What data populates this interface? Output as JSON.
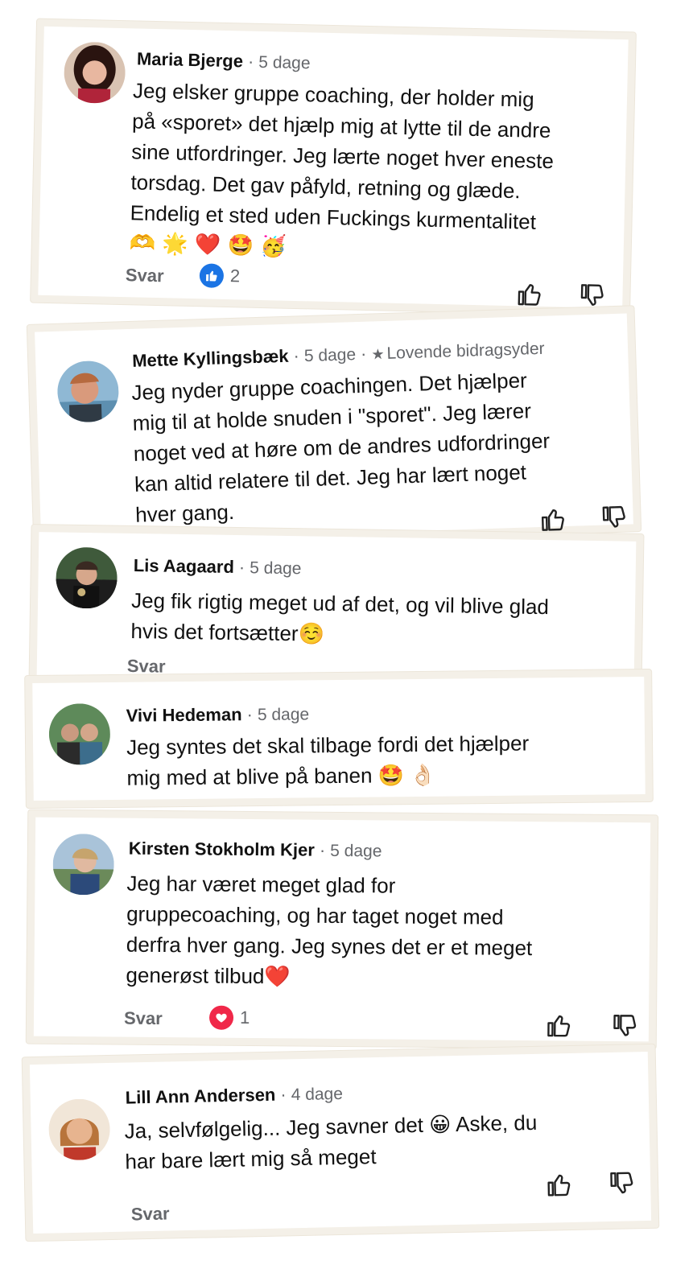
{
  "comments": [
    {
      "name": "Maria Bjerge",
      "time": "5 dage",
      "text": "Jeg elsker gruppe coaching, der holder mig\npå «sporet» det hjælp mig at lytte til de andre\nsine utfordringer. Jeg lærte noget hver eneste\ntorsdag. Det gav påfyld, retning og glæde.\nEndelig et sted uden Fuckings kurmentalitet",
      "emojis": "🫶 🌟 ❤️ 🤩 🥳",
      "reply_label": "Svar",
      "reaction_count": "2",
      "reaction_type": "like"
    },
    {
      "name": "Mette Kyllingsbæk",
      "time": "5 dage",
      "badge": "Lovende bidragsyder",
      "text": "Jeg nyder gruppe coachingen. Det hjælper\nmig til at holde snuden i \"sporet\". Jeg lærer\nnoget ved at høre om de andres udfordringer\nkan altid relatere til det. Jeg har lært noget\nhver gang."
    },
    {
      "name": "Lis Aagaard",
      "time": "5 dage",
      "text": "Jeg fik rigtig meget ud af det, og vil blive glad\nhvis det fortsætter☺️",
      "reply_label": "Svar"
    },
    {
      "name": "Vivi Hedeman",
      "time": "5 dage",
      "text": "Jeg syntes det skal tilbage fordi det hjælper\nmig med at blive på banen 🤩 👌🏻"
    },
    {
      "name": "Kirsten Stokholm Kjer",
      "time": "5 dage",
      "text": "Jeg har været meget glad for\ngruppecoaching, og har taget noget med\nderfra hver gang. Jeg synes det er et meget\ngenerøst tilbud❤️",
      "reply_label": "Svar",
      "reaction_count": "1",
      "reaction_type": "love"
    },
    {
      "name": "Lill Ann Andersen",
      "time": "4 dage",
      "text": "Ja, selvfølgelig... Jeg savner det 😀 Aske, du\nhar bare lært mig så meget",
      "reply_label": "Svar"
    }
  ],
  "colors": {
    "frame": "#f4f0e8",
    "meta_gray": "#65676b",
    "like_blue": "#1b74e4",
    "love_red": "#f02849"
  },
  "icons": [
    "thumbs-up-icon",
    "thumbs-down-icon",
    "like-reaction-icon",
    "heart-reaction-icon",
    "star-icon"
  ]
}
